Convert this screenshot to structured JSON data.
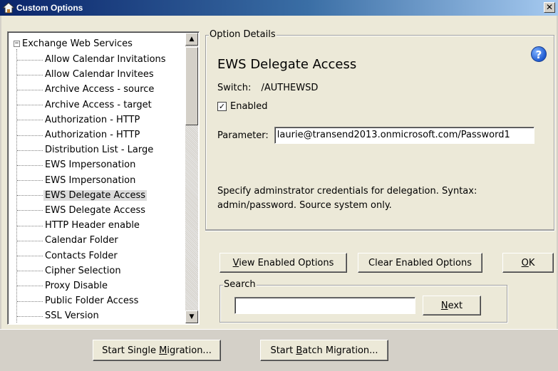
{
  "window": {
    "title": "Custom Options",
    "close_glyph": "✕"
  },
  "tree": {
    "root_label": "Exchange Web Services",
    "expander": "−",
    "items": [
      {
        "label": "Allow Calendar Invitations"
      },
      {
        "label": "Allow Calendar Invitees"
      },
      {
        "label": "Archive Access - source"
      },
      {
        "label": "Archive Access - target"
      },
      {
        "label": "Authorization - HTTP"
      },
      {
        "label": "Authorization - HTTP"
      },
      {
        "label": "Distribution List - Large"
      },
      {
        "label": "EWS Impersonation"
      },
      {
        "label": "EWS Impersonation"
      },
      {
        "label": "EWS Delegate Access",
        "selected": true
      },
      {
        "label": "EWS Delegate Access"
      },
      {
        "label": "HTTP Header enable"
      },
      {
        "label": "Calendar Folder"
      },
      {
        "label": "Contacts Folder"
      },
      {
        "label": "Cipher Selection"
      },
      {
        "label": "Proxy Disable"
      },
      {
        "label": "Public Folder Access"
      },
      {
        "label": "SSL Version"
      }
    ],
    "scroll_up_glyph": "▲",
    "scroll_down_glyph": "▼"
  },
  "details": {
    "legend": "Option Details",
    "help_glyph": "?",
    "title": "EWS Delegate Access",
    "switch_label": "Switch:",
    "switch_value": "/AUTHEWSD",
    "enabled_checked_glyph": "✓",
    "enabled_label": "Enabled",
    "parameter_label": "Parameter:",
    "parameter_value": "laurie@transend2013.onmicrosoft.com/Password1",
    "description": "Specify adminstrator credentials for delegation. Syntax: admin/password. Source system only."
  },
  "buttons": {
    "view_enabled_prefix": "",
    "view_enabled_mnemonic": "V",
    "view_enabled_rest": "iew Enabled Options",
    "clear_enabled": "Clear Enabled Options",
    "ok_mnemonic": "O",
    "ok_rest": "K",
    "next_mnemonic": "N",
    "next_rest": "ext",
    "start_single_prefix": "Start Single ",
    "start_single_mnemonic": "M",
    "start_single_rest": "igration...",
    "start_batch_prefix": "Start ",
    "start_batch_mnemonic": "B",
    "start_batch_rest": "atch Migration..."
  },
  "search": {
    "legend": "Search",
    "value": ""
  },
  "colors": {
    "title_gradient_start": "#0a246a",
    "title_gradient_end": "#a6caf0",
    "help_icon": "#1f5bd1",
    "selected_row": "#dcdcdc"
  }
}
